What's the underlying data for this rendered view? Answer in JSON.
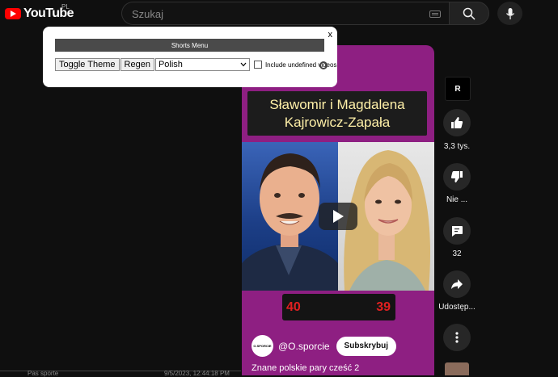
{
  "header": {
    "logo_text": "YouTube",
    "region": "PL",
    "search_placeholder": "Szukaj"
  },
  "shorts_menu": {
    "title": "Shorts Menu",
    "close_label": "x",
    "toggle_theme_label": "Toggle Theme",
    "regen_label": "Regen",
    "language_selected": "Polish",
    "include_undefined_label": "Include undefined videos"
  },
  "short": {
    "title_line1": "Sławomir i Magdalena",
    "title_line2": "Kajrowicz-Zapała",
    "score_left": "40",
    "score_right": "39",
    "channel_avatar_text": "O.SPORCIE",
    "channel_name": "@O.sporcie",
    "subscribe_label": "Subskrybuj",
    "caption": "Znane polskie pary cześć 2"
  },
  "actions": {
    "channel_badge": "R",
    "like_count": "3,3 tys.",
    "dislike_label": "Nie ...",
    "comment_count": "32",
    "share_label": "Udostęp..."
  },
  "bottom": {
    "left_text": "Pas sporte",
    "right_text": "9/5/2023, 12:44:18 PM"
  },
  "colors": {
    "background": "#0f0f0f",
    "accent_red": "#ff0000",
    "short_background": "#8e1f82",
    "title_text": "#fff0a8",
    "score_red": "#e02020"
  }
}
